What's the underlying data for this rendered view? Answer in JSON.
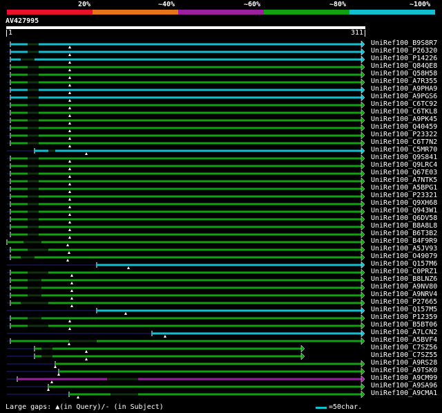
{
  "scale": {
    "labels": [
      "20%",
      "~40%",
      "~60%",
      "~80%",
      "~100%"
    ],
    "colors": [
      "#e8102a",
      "#e8741a",
      "#9c1fa0",
      "#10a010",
      "#10c0d0"
    ]
  },
  "query": {
    "name": "AV427995",
    "start": "1",
    "end": "311"
  },
  "hits": [
    "UniRef100_B9S8R7",
    "UniRef100_P26320",
    "UniRef100_P14226",
    "UniRef100_Q84QE8",
    "UniRef100_Q58H58",
    "UniRef100_A7R355",
    "UniRef100_A9PHA9",
    "UniRef100_A9PGS6",
    "UniRef100_C6TC92",
    "UniRef100_C6TKL8",
    "UniRef100_A9PK45",
    "UniRef100_Q40459",
    "UniRef100_P23322",
    "UniRef100_C6T7N2",
    "UniRef100_C5MR70",
    "UniRef100_Q9S841",
    "UniRef100_Q9LRC4",
    "UniRef100_Q67E03",
    "UniRef100_A7NTK5",
    "UniRef100_A5BPG1",
    "UniRef100_P23321",
    "UniRef100_Q9XH68",
    "UniRef100_Q943W1",
    "UniRef100_Q6DV58",
    "UniRef100_B8A8L8",
    "UniRef100_B6T3B2",
    "UniRef100_B4F9R9",
    "UniRef100_A5JV93",
    "UniRef100_O49079",
    "UniRef100_Q157M6",
    "UniRef100_C0PRZ1",
    "UniRef100_B8LNZ6",
    "UniRef100_A9NV80",
    "UniRef100_A9NRV4",
    "UniRef100_P27665",
    "UniRef100_Q157M5",
    "UniRef100_P12359",
    "UniRef100_B5BT06",
    "UniRef100_A7LCN2",
    "UniRef100_A5BVF4",
    "UniRef100_C7SZ56",
    "UniRef100_C7SZ55",
    "UniRef100_A9RS28",
    "UniRef100_A9TSK0",
    "UniRef100_A9CM99",
    "UniRef100_A9SA96",
    "UniRef100_A9CMA1"
  ],
  "legend": {
    "gaps": "Large gaps: ▲(in Query)/- (in Subject)",
    "scale": "=50char.",
    "color": "#10c0d0"
  }
}
